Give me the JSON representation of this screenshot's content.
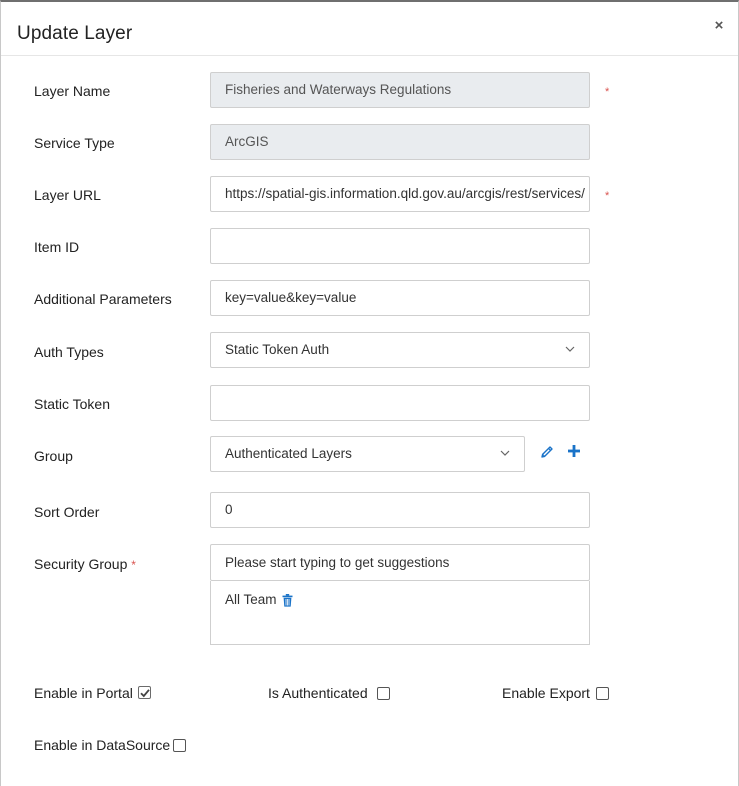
{
  "dialog": {
    "title": "Update Layer",
    "close_symbol": "×"
  },
  "fields": {
    "layer_name": {
      "label": "Layer Name",
      "value": "Fisheries and Waterways Regulations",
      "required_mark": "*"
    },
    "service_type": {
      "label": "Service Type",
      "value": "ArcGIS"
    },
    "layer_url": {
      "label": "Layer URL",
      "value": "https://spatial-gis.information.qld.gov.au/arcgis/rest/services/",
      "required_mark": "*"
    },
    "item_id": {
      "label": "Item ID",
      "value": ""
    },
    "additional_parameters": {
      "label": "Additional Parameters",
      "value": "key=value&key=value"
    },
    "auth_types": {
      "label": "Auth Types",
      "selected": "Static Token Auth"
    },
    "static_token": {
      "label": "Static Token",
      "value": ""
    },
    "group": {
      "label": "Group",
      "selected": "Authenticated Layers"
    },
    "sort_order": {
      "label": "Sort Order",
      "value": "0"
    },
    "security_group": {
      "label": "Security Group",
      "required_mark": "*",
      "placeholder": "Please start typing to get suggestions",
      "tags": [
        "All Team"
      ]
    }
  },
  "checkboxes": {
    "enable_in_portal": {
      "label": "Enable in Portal",
      "checked": true
    },
    "is_authenticated": {
      "label": "Is Authenticated",
      "checked": false
    },
    "enable_export": {
      "label": "Enable Export",
      "checked": false
    },
    "enable_in_datasource": {
      "label": "Enable in DataSource",
      "checked": false
    }
  },
  "icons": {
    "edit": "pencil-icon",
    "add": "plus-icon",
    "remove_tag": "trash-icon",
    "dropdown": "chevron-down-icon",
    "close": "close-icon"
  },
  "colors": {
    "accent": "#1a73c8",
    "required": "#d9534f",
    "disabled_bg": "#e9ecef"
  }
}
